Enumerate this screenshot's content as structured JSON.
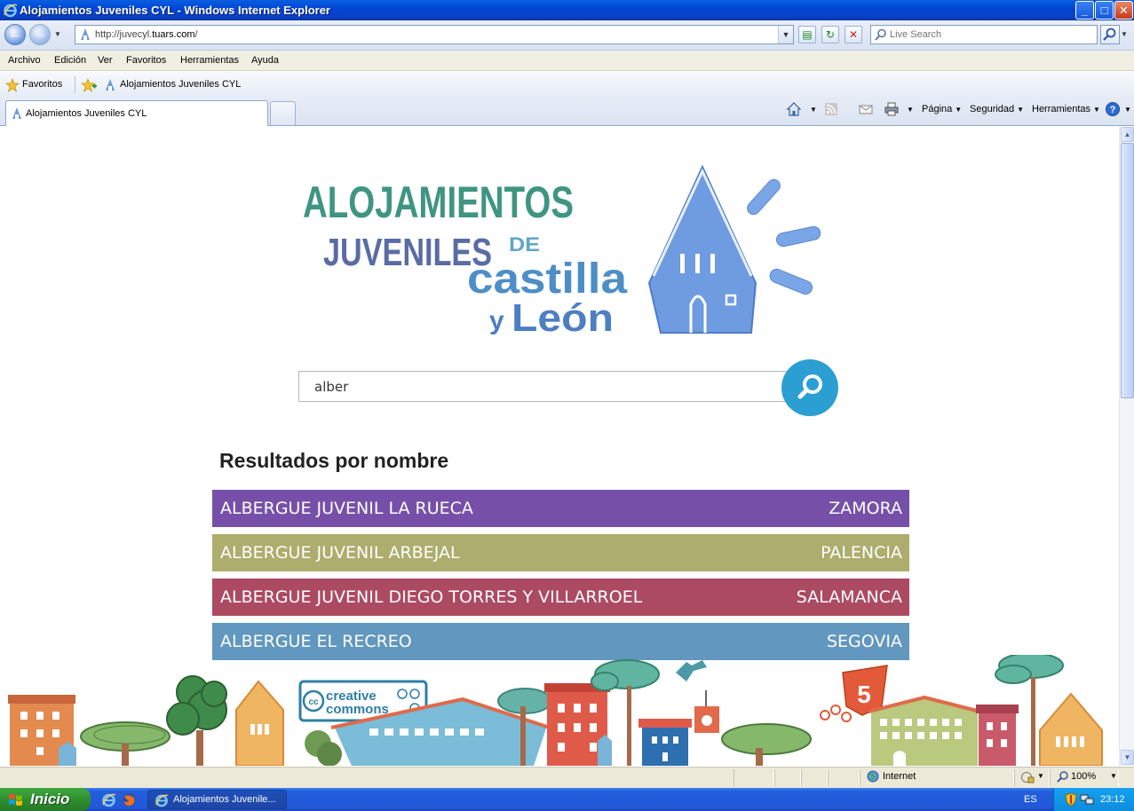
{
  "window": {
    "title": "Alojamientos Juveniles CYL - Windows Internet Explorer",
    "minimize": "_",
    "maximize": "□",
    "close": "✕"
  },
  "address_bar": {
    "url_prefix": "http://juvecyl.",
    "url_domain": "tuars.com",
    "url_suffix": "/",
    "search_placeholder": "Live Search"
  },
  "menu": [
    "Archivo",
    "Edición",
    "Ver",
    "Favoritos",
    "Herramientas",
    "Ayuda"
  ],
  "favorites_bar": {
    "favorites_label": "Favoritos",
    "site_label": "Alojamientos Juveniles CYL"
  },
  "tabs": {
    "active_label": "Alojamientos Juveniles CYL"
  },
  "command_bar": {
    "page": "Página",
    "security": "Seguridad",
    "tools": "Herramientas"
  },
  "site": {
    "logo_text": {
      "line1": "ALOJAMIENTOS",
      "line2": "JUVENILES",
      "de": "DE",
      "line3": "castilla",
      "y": "y",
      "line4": "León"
    },
    "search_value": "alber",
    "results_title": "Resultados por nombre",
    "results": [
      {
        "name": "ALBERGUE JUVENIL LA RUECA",
        "province": "ZAMORA",
        "color": "#7650a8"
      },
      {
        "name": "ALBERGUE JUVENIL ARBEJAL",
        "province": "PALENCIA",
        "color": "#adad6e"
      },
      {
        "name": "ALBERGUE JUVENIL DIEGO TORRES Y VILLARROEL",
        "province": "SALAMANCA",
        "color": "#ac4a62"
      },
      {
        "name": "ALBERGUE EL RECREO",
        "province": "SEGOVIA",
        "color": "#6297bf"
      }
    ],
    "footer": {
      "cc_line1": "creative",
      "cc_line2": "commons",
      "cc_badge": "cc",
      "html5_badge": "5"
    }
  },
  "status_bar": {
    "zone": "Internet",
    "zoom": "100%"
  },
  "taskbar": {
    "start_label": "Inicio",
    "task_label": "Alojamientos Juvenile...",
    "language": "ES",
    "clock": "23:12"
  },
  "colors": {
    "title_bar": "#0046d6",
    "search_button": "#2b9fd2",
    "logo_teal": "#3f9582",
    "logo_blue": "#5b8ccf",
    "house_blue": "#6f9be0"
  },
  "icons": [
    "ie-logo-icon",
    "back-arrow-icon",
    "forward-arrow-icon",
    "site-favicon-icon",
    "compatibility-icon",
    "refresh-icon",
    "stop-icon",
    "search-icon",
    "favorites-star-icon",
    "add-favorites-icon",
    "home-icon",
    "feeds-icon",
    "mail-icon",
    "print-icon",
    "help-icon",
    "globe-icon",
    "protected-mode-icon",
    "windows-flag-icon",
    "firefox-icon",
    "security-shield-icon"
  ]
}
